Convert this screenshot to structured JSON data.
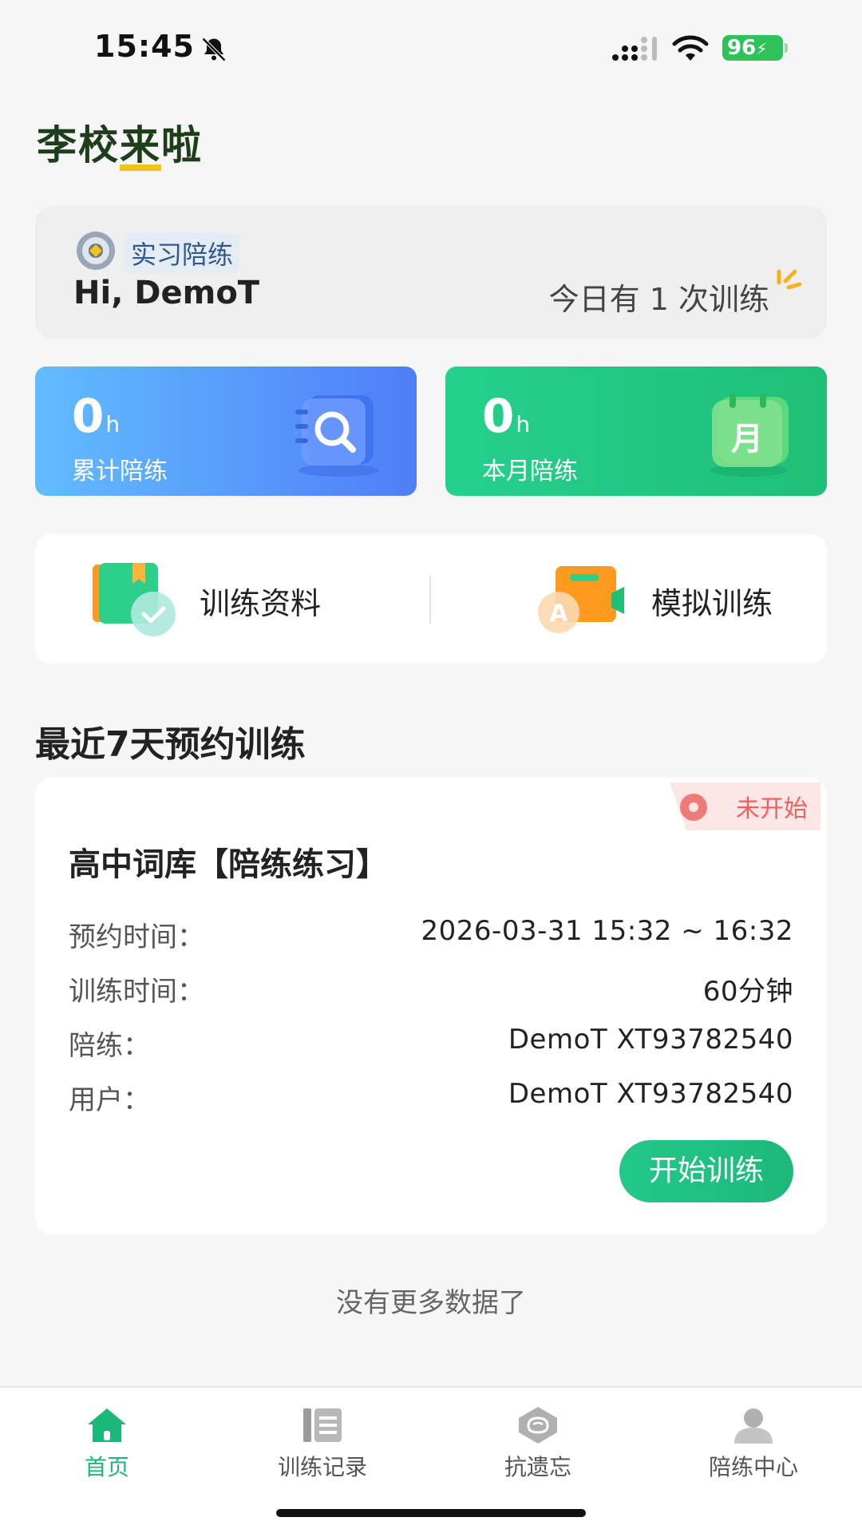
{
  "status_bar": {
    "time": "15:45",
    "battery": "96",
    "icons": [
      "bell-muted-icon",
      "signal-icon",
      "wifi-icon",
      "battery-icon"
    ]
  },
  "app": {
    "logo_text_a": "李校",
    "logo_text_b": "来",
    "logo_text_c": "啦"
  },
  "greeting": {
    "role_tag": "实习陪练",
    "hi": "Hi, DemoT",
    "today": "今日有 1 次训练"
  },
  "stats": [
    {
      "value": "0",
      "unit": "h",
      "label": "累计陪练",
      "icon": "search-book-icon"
    },
    {
      "value": "0",
      "unit": "h",
      "label": "本月陪练",
      "icon": "calendar-month-icon",
      "icon_text": "月"
    }
  ],
  "actions": [
    {
      "label": "训练资料",
      "icon": "training-material-icon"
    },
    {
      "label": "模拟训练",
      "icon": "mock-training-icon",
      "icon_letter": "A"
    }
  ],
  "section_title": "最近7天预约训练",
  "booking": {
    "status": "未开始",
    "title": "高中词库【陪练练习】",
    "rows": [
      {
        "label": "预约时间：",
        "value": "2026-03-31 15:32 ~ 16:32"
      },
      {
        "label": "训练时间：",
        "value": "60分钟"
      },
      {
        "label": "陪练：",
        "value": "DemoT XT93782540"
      },
      {
        "label": "用户：",
        "value": "DemoT XT93782540"
      }
    ],
    "start_button": "开始训练"
  },
  "no_more": "没有更多数据了",
  "tabs": [
    {
      "label": "首页",
      "icon": "home-icon",
      "active": true
    },
    {
      "label": "训练记录",
      "icon": "record-list-icon",
      "active": false
    },
    {
      "label": "抗遗忘",
      "icon": "brain-icon",
      "active": false
    },
    {
      "label": "陪练中心",
      "icon": "user-icon",
      "active": false
    }
  ],
  "colors": {
    "accent_green": "#1cb87a",
    "stat_blue": "#4f7ef8",
    "status_red": "#f0605f"
  }
}
